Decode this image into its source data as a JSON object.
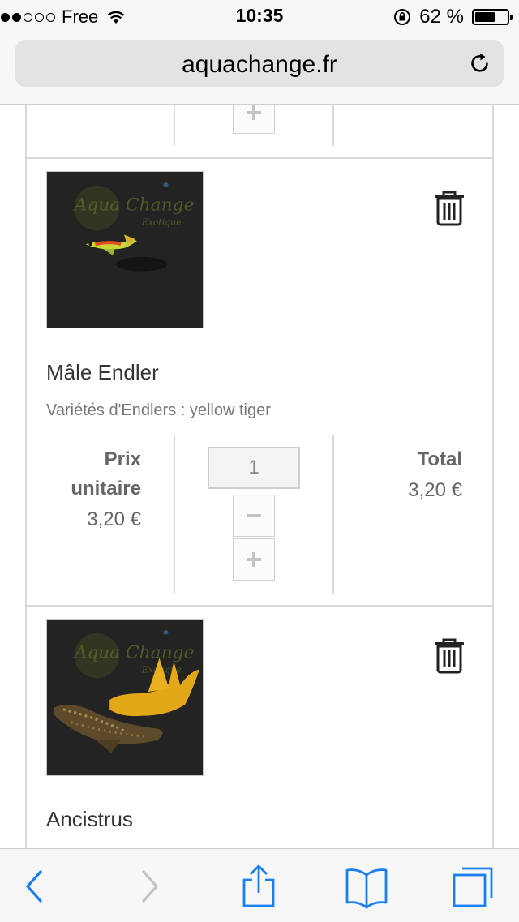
{
  "status_bar": {
    "carrier": "Free",
    "time": "10:35",
    "battery_text": "62 %",
    "battery_level": 0.62
  },
  "browser": {
    "url": "aquachange.fr"
  },
  "cart": {
    "items": [
      {
        "name": "Mâle Endler",
        "variant": "Variétés d'Endlers : yellow tiger",
        "unit_price_label": "Prix unitaire",
        "unit_price": "3,20 €",
        "quantity": "1",
        "total_label": "Total",
        "total": "3,20 €",
        "image_watermark": "Aqua Change Exotique"
      },
      {
        "name": "Ancistrus",
        "image_watermark": "Aqua Change Exotique"
      }
    ]
  },
  "icons": {
    "status": [
      "signal-dots-icon",
      "wifi-icon",
      "orientation-lock-icon",
      "battery-icon"
    ],
    "url_bar": [
      "reload-icon"
    ],
    "cart": [
      "trash-icon",
      "minus-icon",
      "plus-icon"
    ],
    "toolbar": [
      "back-icon",
      "forward-icon",
      "share-icon",
      "bookmarks-icon",
      "tabs-icon"
    ]
  },
  "colors": {
    "ios_blue": "#1a7ff0",
    "disabled_gray": "#c4c4c4",
    "text_gray": "#666666",
    "border_gray": "#d9d9d9"
  }
}
